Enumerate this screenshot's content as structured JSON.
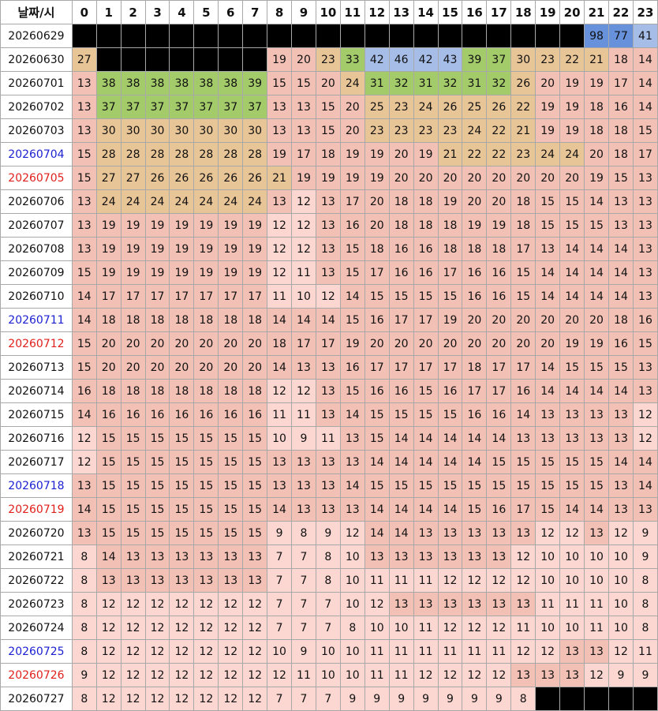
{
  "table": {
    "corner_label": "날짜/시",
    "hours": [
      "0",
      "1",
      "2",
      "3",
      "4",
      "5",
      "6",
      "7",
      "8",
      "9",
      "10",
      "11",
      "12",
      "13",
      "14",
      "15",
      "16",
      "17",
      "18",
      "19",
      "20",
      "21",
      "22",
      "23"
    ],
    "rows": [
      {
        "date": "20260629",
        "day_type": "weekday",
        "values": [
          null,
          null,
          null,
          null,
          null,
          null,
          null,
          null,
          null,
          null,
          null,
          null,
          null,
          null,
          null,
          null,
          null,
          null,
          null,
          null,
          null,
          98,
          77,
          41
        ]
      },
      {
        "date": "20260630",
        "day_type": "weekday",
        "values": [
          27,
          null,
          null,
          null,
          null,
          null,
          null,
          null,
          19,
          20,
          23,
          33,
          42,
          46,
          42,
          43,
          39,
          37,
          30,
          23,
          22,
          21,
          18,
          14
        ]
      },
      {
        "date": "20260701",
        "day_type": "weekday",
        "values": [
          13,
          38,
          38,
          38,
          38,
          38,
          38,
          39,
          15,
          15,
          20,
          24,
          31,
          32,
          31,
          32,
          31,
          32,
          26,
          20,
          19,
          19,
          17,
          14
        ]
      },
      {
        "date": "20260702",
        "day_type": "weekday",
        "values": [
          13,
          37,
          37,
          37,
          37,
          37,
          37,
          37,
          13,
          13,
          15,
          20,
          25,
          23,
          24,
          26,
          25,
          26,
          22,
          19,
          19,
          18,
          16,
          14
        ]
      },
      {
        "date": "20260703",
        "day_type": "weekday",
        "values": [
          13,
          30,
          30,
          30,
          30,
          30,
          30,
          30,
          13,
          13,
          15,
          20,
          23,
          23,
          23,
          23,
          24,
          22,
          21,
          19,
          19,
          18,
          18,
          15
        ]
      },
      {
        "date": "20260704",
        "day_type": "saturday",
        "values": [
          15,
          28,
          28,
          28,
          28,
          28,
          28,
          28,
          19,
          17,
          18,
          19,
          19,
          20,
          19,
          21,
          22,
          22,
          23,
          24,
          24,
          20,
          18,
          17
        ]
      },
      {
        "date": "20260705",
        "day_type": "sunday",
        "values": [
          15,
          27,
          27,
          26,
          26,
          26,
          26,
          26,
          21,
          19,
          19,
          19,
          19,
          20,
          20,
          20,
          20,
          20,
          20,
          20,
          20,
          19,
          15,
          13
        ]
      },
      {
        "date": "20260706",
        "day_type": "weekday",
        "values": [
          13,
          24,
          24,
          24,
          24,
          24,
          24,
          24,
          13,
          12,
          13,
          17,
          20,
          18,
          18,
          19,
          20,
          20,
          18,
          15,
          15,
          14,
          13,
          13
        ]
      },
      {
        "date": "20260707",
        "day_type": "weekday",
        "values": [
          13,
          19,
          19,
          19,
          19,
          19,
          19,
          19,
          12,
          12,
          13,
          16,
          20,
          18,
          18,
          18,
          19,
          19,
          18,
          15,
          15,
          15,
          13,
          13
        ]
      },
      {
        "date": "20260708",
        "day_type": "weekday",
        "values": [
          13,
          19,
          19,
          19,
          19,
          19,
          19,
          19,
          12,
          12,
          13,
          15,
          18,
          16,
          16,
          18,
          18,
          18,
          17,
          13,
          14,
          14,
          14,
          13
        ]
      },
      {
        "date": "20260709",
        "day_type": "weekday",
        "values": [
          15,
          19,
          19,
          19,
          19,
          19,
          19,
          19,
          12,
          11,
          13,
          15,
          17,
          16,
          16,
          17,
          16,
          16,
          15,
          14,
          14,
          14,
          14,
          13
        ]
      },
      {
        "date": "20260710",
        "day_type": "weekday",
        "values": [
          14,
          17,
          17,
          17,
          17,
          17,
          17,
          17,
          11,
          10,
          12,
          14,
          15,
          15,
          15,
          15,
          16,
          16,
          15,
          14,
          14,
          14,
          14,
          13
        ]
      },
      {
        "date": "20260711",
        "day_type": "saturday",
        "values": [
          14,
          18,
          18,
          18,
          18,
          18,
          18,
          18,
          14,
          14,
          14,
          15,
          16,
          17,
          17,
          19,
          20,
          20,
          20,
          20,
          20,
          20,
          18,
          16
        ]
      },
      {
        "date": "20260712",
        "day_type": "sunday",
        "values": [
          15,
          20,
          20,
          20,
          20,
          20,
          20,
          20,
          18,
          17,
          17,
          19,
          20,
          20,
          20,
          20,
          20,
          20,
          20,
          20,
          19,
          19,
          16,
          15
        ]
      },
      {
        "date": "20260713",
        "day_type": "weekday",
        "values": [
          15,
          20,
          20,
          20,
          20,
          20,
          20,
          20,
          14,
          13,
          13,
          16,
          17,
          17,
          17,
          17,
          18,
          17,
          17,
          14,
          15,
          15,
          15,
          13
        ]
      },
      {
        "date": "20260714",
        "day_type": "weekday",
        "values": [
          16,
          18,
          18,
          18,
          18,
          18,
          18,
          18,
          12,
          12,
          13,
          15,
          16,
          16,
          15,
          16,
          17,
          17,
          16,
          14,
          14,
          14,
          14,
          13
        ]
      },
      {
        "date": "20260715",
        "day_type": "weekday",
        "values": [
          14,
          16,
          16,
          16,
          16,
          16,
          16,
          16,
          11,
          11,
          13,
          14,
          15,
          15,
          15,
          15,
          16,
          16,
          14,
          13,
          13,
          13,
          13,
          12
        ]
      },
      {
        "date": "20260716",
        "day_type": "weekday",
        "values": [
          12,
          15,
          15,
          15,
          15,
          15,
          15,
          15,
          10,
          9,
          11,
          13,
          15,
          14,
          14,
          14,
          14,
          14,
          13,
          13,
          13,
          13,
          13,
          12
        ]
      },
      {
        "date": "20260717",
        "day_type": "weekday",
        "values": [
          12,
          15,
          15,
          15,
          15,
          15,
          15,
          15,
          13,
          13,
          13,
          13,
          14,
          14,
          14,
          14,
          14,
          15,
          15,
          15,
          15,
          15,
          14,
          14
        ]
      },
      {
        "date": "20260718",
        "day_type": "saturday",
        "values": [
          13,
          15,
          15,
          15,
          15,
          15,
          15,
          15,
          13,
          13,
          13,
          14,
          15,
          15,
          15,
          15,
          15,
          15,
          15,
          15,
          15,
          15,
          13,
          14
        ]
      },
      {
        "date": "20260719",
        "day_type": "sunday",
        "values": [
          14,
          15,
          15,
          15,
          15,
          15,
          15,
          15,
          14,
          13,
          13,
          13,
          14,
          14,
          14,
          14,
          15,
          16,
          17,
          15,
          14,
          14,
          13,
          13
        ]
      },
      {
        "date": "20260720",
        "day_type": "weekday",
        "values": [
          13,
          15,
          15,
          15,
          15,
          15,
          15,
          15,
          9,
          8,
          9,
          12,
          14,
          14,
          13,
          13,
          13,
          13,
          13,
          12,
          12,
          13,
          12,
          9
        ]
      },
      {
        "date": "20260721",
        "day_type": "weekday",
        "values": [
          8,
          14,
          13,
          13,
          13,
          13,
          13,
          13,
          7,
          7,
          8,
          10,
          13,
          13,
          13,
          13,
          13,
          13,
          12,
          10,
          10,
          10,
          10,
          9
        ]
      },
      {
        "date": "20260722",
        "day_type": "weekday",
        "values": [
          8,
          13,
          13,
          13,
          13,
          13,
          13,
          13,
          7,
          7,
          8,
          10,
          11,
          11,
          11,
          12,
          12,
          12,
          12,
          10,
          10,
          10,
          10,
          8
        ]
      },
      {
        "date": "20260723",
        "day_type": "weekday",
        "values": [
          8,
          12,
          12,
          12,
          12,
          12,
          12,
          12,
          7,
          7,
          7,
          10,
          12,
          13,
          13,
          13,
          13,
          13,
          13,
          11,
          11,
          11,
          10,
          8
        ]
      },
      {
        "date": "20260724",
        "day_type": "weekday",
        "values": [
          8,
          12,
          12,
          12,
          12,
          12,
          12,
          12,
          7,
          7,
          7,
          8,
          10,
          10,
          11,
          12,
          12,
          12,
          11,
          10,
          10,
          11,
          10,
          8
        ]
      },
      {
        "date": "20260725",
        "day_type": "saturday",
        "values": [
          8,
          12,
          12,
          12,
          12,
          12,
          12,
          12,
          10,
          9,
          10,
          10,
          11,
          11,
          11,
          11,
          11,
          11,
          12,
          12,
          13,
          13,
          12,
          11
        ]
      },
      {
        "date": "20260726",
        "day_type": "sunday",
        "values": [
          9,
          12,
          12,
          12,
          12,
          12,
          12,
          12,
          12,
          11,
          10,
          10,
          11,
          11,
          12,
          12,
          12,
          12,
          13,
          13,
          13,
          12,
          9,
          9
        ]
      },
      {
        "date": "20260727",
        "day_type": "weekday",
        "values": [
          8,
          12,
          12,
          12,
          12,
          12,
          12,
          12,
          7,
          7,
          7,
          9,
          9,
          9,
          9,
          9,
          9,
          9,
          8,
          null,
          null,
          null,
          null,
          null
        ]
      }
    ]
  },
  "colors": {
    "no_data": "#000000",
    "very_low": "#fcd7d2",
    "low": "#f2c0b4",
    "medium": "#e8c597",
    "high": "#a4cb69",
    "very_high": "#a6bde8",
    "extreme": "#6791db",
    "saturday_text": "#1a1fd1",
    "sunday_text": "#e0201c",
    "weekday_text": "#111111"
  }
}
